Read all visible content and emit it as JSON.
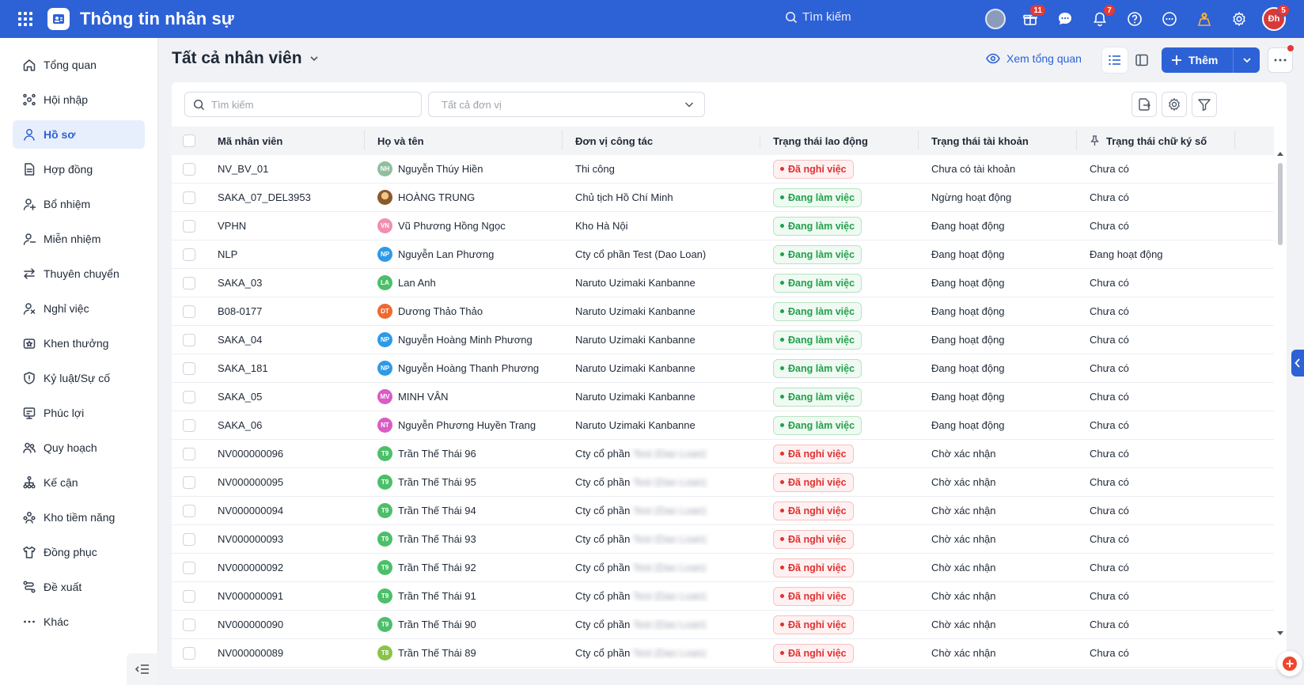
{
  "app": {
    "title": "Thông tin nhân sự"
  },
  "topbar": {
    "search_label": "Tìm kiếm",
    "gift_badge": "11",
    "bell_badge": "7",
    "user_badge": "5",
    "user_initials": "Đh"
  },
  "sidebar": {
    "items": [
      {
        "label": "Tổng quan",
        "icon": "home-icon"
      },
      {
        "label": "Hội nhập",
        "icon": "onboarding-icon"
      },
      {
        "label": "Hồ sơ",
        "icon": "profile-icon",
        "active": true
      },
      {
        "label": "Hợp đồng",
        "icon": "contract-icon"
      },
      {
        "label": "Bổ nhiệm",
        "icon": "appoint-icon"
      },
      {
        "label": "Miễn nhiệm",
        "icon": "dismiss-icon"
      },
      {
        "label": "Thuyên chuyển",
        "icon": "transfer-icon"
      },
      {
        "label": "Nghỉ việc",
        "icon": "resign-icon"
      },
      {
        "label": "Khen thưởng",
        "icon": "reward-icon"
      },
      {
        "label": "Kỷ luật/Sự cố",
        "icon": "discipline-icon"
      },
      {
        "label": "Phúc lợi",
        "icon": "welfare-icon"
      },
      {
        "label": "Quy hoạch",
        "icon": "planning-icon"
      },
      {
        "label": "Kế cận",
        "icon": "succession-icon"
      },
      {
        "label": "Kho tiềm năng",
        "icon": "talent-pool-icon"
      },
      {
        "label": "Đồng phục",
        "icon": "uniform-icon"
      },
      {
        "label": "Đề xuất",
        "icon": "proposal-icon"
      },
      {
        "label": "Khác",
        "icon": "more-icon"
      }
    ]
  },
  "header": {
    "title": "Tất cả nhân viên",
    "overview_label": "Xem tổng quan",
    "add_label": "Thêm"
  },
  "filters": {
    "search_placeholder": "Tìm kiếm",
    "unit_placeholder": "Tất cả đơn vị"
  },
  "table": {
    "columns": [
      "Mã nhân viên",
      "Họ và tên",
      "Đơn vị công tác",
      "Trạng thái lao động",
      "Trạng thái tài khoản",
      "Trạng thái chữ ký số"
    ],
    "rows": [
      {
        "code": "NV_BV_01",
        "initials": "NH",
        "avatar_color": "#8fbf9f",
        "name": "Nguyễn Thúy Hiền",
        "unit": "Thi công",
        "unit_blur": "",
        "work": "Đã nghỉ việc",
        "work_tone": "red",
        "account": "Chưa có tài khoản",
        "sign": "Chưa có"
      },
      {
        "code": "SAKA_07_DEL3953",
        "initials": "",
        "avatar_color": "#a0713a",
        "name": "HOÀNG TRUNG",
        "unit": "Chủ tịch Hồ Chí Minh",
        "unit_blur": "",
        "work": "Đang làm việc",
        "work_tone": "green",
        "account": "Ngừng hoạt động",
        "sign": "Chưa có"
      },
      {
        "code": "VPHN",
        "initials": "VN",
        "avatar_color": "#f08fb1",
        "name": "Vũ Phương Hồng Ngọc",
        "unit": "Kho Hà Nội",
        "unit_blur": "",
        "work": "Đang làm việc",
        "work_tone": "green",
        "account": "Đang hoạt động",
        "sign": "Chưa có"
      },
      {
        "code": "NLP",
        "initials": "NP",
        "avatar_color": "#2d9ae8",
        "name": "Nguyễn Lan Phương",
        "unit": "Cty cổ phần Test (Dao Loan)",
        "unit_blur": "",
        "work": "Đang làm việc",
        "work_tone": "green",
        "account": "Đang hoạt động",
        "sign": "Đang hoạt động"
      },
      {
        "code": "SAKA_03",
        "initials": "LA",
        "avatar_color": "#4cbf6a",
        "name": "Lan Anh",
        "unit": "Naruto Uzimaki Kanbanne",
        "unit_blur": "",
        "work": "Đang làm việc",
        "work_tone": "green",
        "account": "Đang hoạt động",
        "sign": "Chưa có"
      },
      {
        "code": "B08-0177",
        "initials": "DT",
        "avatar_color": "#ee6a2f",
        "name": "Dương Thảo Thảo",
        "unit": "Naruto Uzimaki Kanbanne",
        "unit_blur": "",
        "work": "Đang làm việc",
        "work_tone": "green",
        "account": "Đang hoạt động",
        "sign": "Chưa có"
      },
      {
        "code": "SAKA_04",
        "initials": "NP",
        "avatar_color": "#2d9ae8",
        "name": "Nguyễn Hoàng Minh Phương",
        "unit": "Naruto Uzimaki Kanbanne",
        "unit_blur": "",
        "work": "Đang làm việc",
        "work_tone": "green",
        "account": "Đang hoạt động",
        "sign": "Chưa có"
      },
      {
        "code": "SAKA_181",
        "initials": "NP",
        "avatar_color": "#2d9ae8",
        "name": "Nguyễn Hoàng Thanh Phương",
        "unit": "Naruto Uzimaki Kanbanne",
        "unit_blur": "",
        "work": "Đang làm việc",
        "work_tone": "green",
        "account": "Đang hoạt động",
        "sign": "Chưa có"
      },
      {
        "code": "SAKA_05",
        "initials": "MV",
        "avatar_color": "#d95bc3",
        "name": "MINH VÂN",
        "unit": "Naruto Uzimaki Kanbanne",
        "unit_blur": "",
        "work": "Đang làm việc",
        "work_tone": "green",
        "account": "Đang hoạt động",
        "sign": "Chưa có"
      },
      {
        "code": "SAKA_06",
        "initials": "NT",
        "avatar_color": "#d95bc3",
        "name": "Nguyễn Phương Huyền Trang",
        "unit": "Naruto Uzimaki Kanbanne",
        "unit_blur": "",
        "work": "Đang làm việc",
        "work_tone": "green",
        "account": "Đang hoạt động",
        "sign": "Chưa có"
      },
      {
        "code": "NV000000096",
        "initials": "T9",
        "avatar_color": "#4cbf6a",
        "name": "Trần Thế Thái 96",
        "unit": "Cty cổ phần",
        "unit_blur": "Test (Dao Loan)",
        "work": "Đã nghỉ việc",
        "work_tone": "red",
        "account": "Chờ xác nhận",
        "sign": "Chưa có"
      },
      {
        "code": "NV000000095",
        "initials": "T9",
        "avatar_color": "#4cbf6a",
        "name": "Trần Thế Thái 95",
        "unit": "Cty cổ phần",
        "unit_blur": "Test (Dao Loan)",
        "work": "Đã nghỉ việc",
        "work_tone": "red",
        "account": "Chờ xác nhận",
        "sign": "Chưa có"
      },
      {
        "code": "NV000000094",
        "initials": "T9",
        "avatar_color": "#4cbf6a",
        "name": "Trần Thế Thái 94",
        "unit": "Cty cổ phần",
        "unit_blur": "Test (Dao Loan)",
        "work": "Đã nghỉ việc",
        "work_tone": "red",
        "account": "Chờ xác nhận",
        "sign": "Chưa có"
      },
      {
        "code": "NV000000093",
        "initials": "T9",
        "avatar_color": "#4cbf6a",
        "name": "Trần Thế Thái 93",
        "unit": "Cty cổ phần",
        "unit_blur": "Test (Dao Loan)",
        "work": "Đã nghỉ việc",
        "work_tone": "red",
        "account": "Chờ xác nhận",
        "sign": "Chưa có"
      },
      {
        "code": "NV000000092",
        "initials": "T9",
        "avatar_color": "#4cbf6a",
        "name": "Trần Thế Thái 92",
        "unit": "Cty cổ phần",
        "unit_blur": "Test (Dao Loan)",
        "work": "Đã nghỉ việc",
        "work_tone": "red",
        "account": "Chờ xác nhận",
        "sign": "Chưa có"
      },
      {
        "code": "NV000000091",
        "initials": "T9",
        "avatar_color": "#4cbf6a",
        "name": "Trần Thế Thái 91",
        "unit": "Cty cổ phần",
        "unit_blur": "Test (Dao Loan)",
        "work": "Đã nghỉ việc",
        "work_tone": "red",
        "account": "Chờ xác nhận",
        "sign": "Chưa có"
      },
      {
        "code": "NV000000090",
        "initials": "T9",
        "avatar_color": "#4cbf6a",
        "name": "Trần Thế Thái 90",
        "unit": "Cty cổ phần",
        "unit_blur": "Test (Dao Loan)",
        "work": "Đã nghỉ việc",
        "work_tone": "red",
        "account": "Chờ xác nhận",
        "sign": "Chưa có"
      },
      {
        "code": "NV000000089",
        "initials": "T8",
        "avatar_color": "#8bc34a",
        "name": "Trần Thế Thái 89",
        "unit": "Cty cổ phần",
        "unit_blur": "Test (Dao Loan)",
        "work": "Đã nghỉ việc",
        "work_tone": "red",
        "account": "Chờ xác nhận",
        "sign": "Chưa có"
      }
    ]
  },
  "colors": {
    "brand": "#2d61d6",
    "active_bg": "#e8effc",
    "danger": "#e03131",
    "success": "#22a04b"
  }
}
